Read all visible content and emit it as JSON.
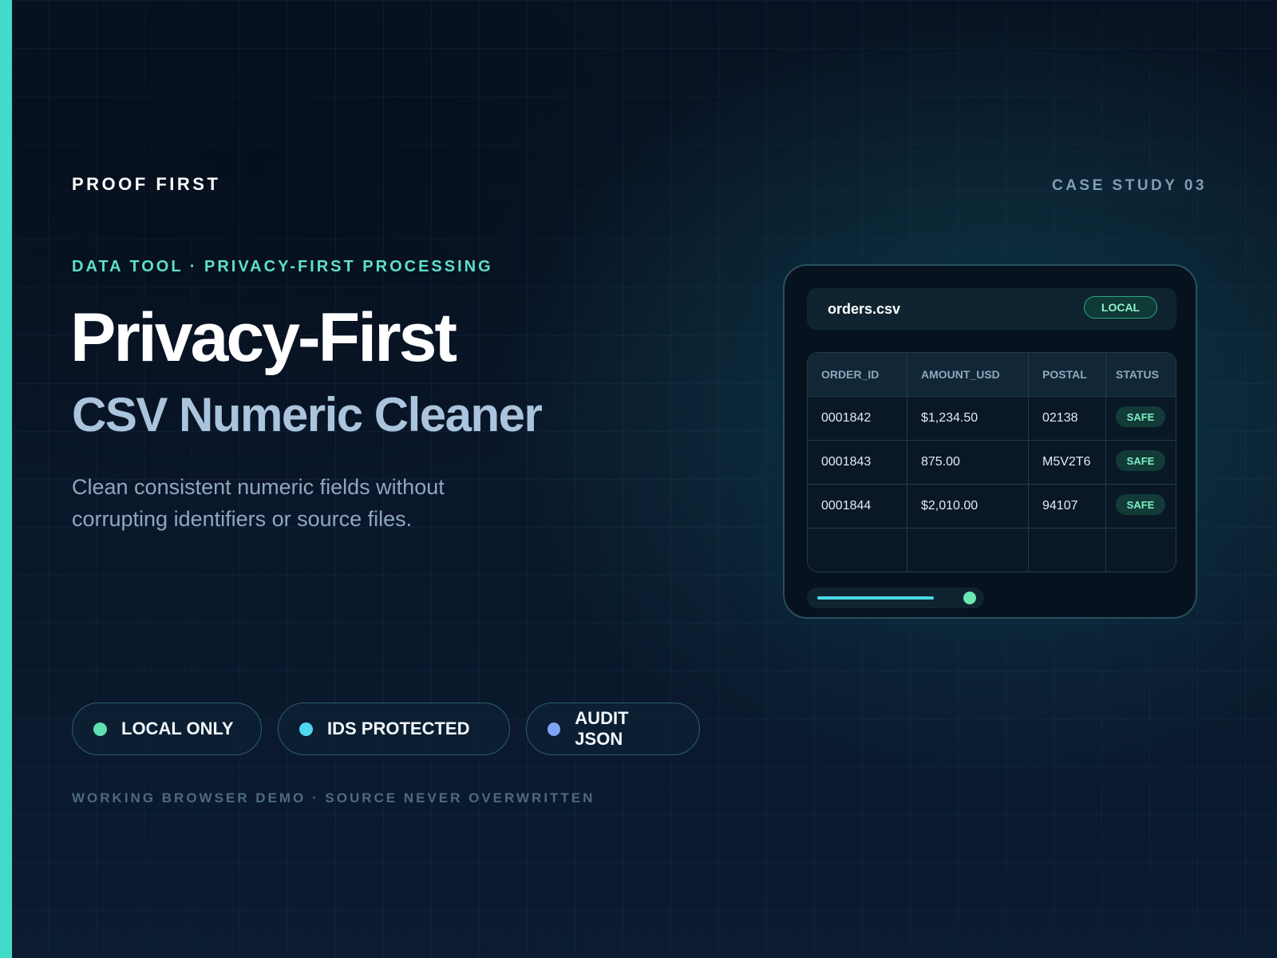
{
  "header": {
    "brand": "PROOF FIRST",
    "case_label": "CASE STUDY 03"
  },
  "hero": {
    "eyebrow": "DATA TOOL · PRIVACY-FIRST PROCESSING",
    "title_line1": "Privacy-First",
    "title_line2": "CSV Numeric Cleaner",
    "description": "Clean consistent numeric fields without corrupting identifiers or source files."
  },
  "pills": [
    {
      "label": "LOCAL ONLY",
      "dot_color": "#5ee0b0"
    },
    {
      "label": "IDS PROTECTED",
      "dot_color": "#4fd8f0"
    },
    {
      "label": "AUDIT JSON",
      "dot_color": "#7fa4f5"
    }
  ],
  "footnote": "WORKING BROWSER DEMO · SOURCE NEVER OVERWRITTEN",
  "preview": {
    "filename": "orders.csv",
    "badge": "LOCAL",
    "columns": [
      "ORDER_ID",
      "AMOUNT_USD",
      "POSTAL",
      "STATUS"
    ],
    "rows": [
      {
        "order_id": "0001842",
        "amount": "$1,234.50",
        "postal": "02138",
        "status": "SAFE"
      },
      {
        "order_id": "0001843",
        "amount": "875.00",
        "postal": "M5V2T6",
        "status": "SAFE"
      },
      {
        "order_id": "0001844",
        "amount": "$2,010.00",
        "postal": "94107",
        "status": "SAFE"
      }
    ],
    "progress": 0.8
  },
  "colors": {
    "accent": "#40dcc9",
    "background": "#0a1526"
  }
}
